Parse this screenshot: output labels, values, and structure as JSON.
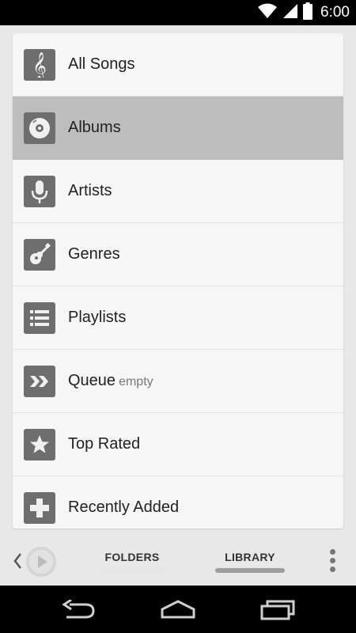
{
  "status_bar": {
    "time": "6:00",
    "icons": [
      "wifi-icon",
      "signal-icon",
      "battery-icon"
    ]
  },
  "library_menu": {
    "items": [
      {
        "label": "All Songs",
        "sub": "",
        "icon": "treble-clef-icon",
        "selected": false
      },
      {
        "label": "Albums",
        "sub": "",
        "icon": "disc-icon",
        "selected": true
      },
      {
        "label": "Artists",
        "sub": "",
        "icon": "microphone-icon",
        "selected": false
      },
      {
        "label": "Genres",
        "sub": "",
        "icon": "guitar-icon",
        "selected": false
      },
      {
        "label": "Playlists",
        "sub": "",
        "icon": "list-icon",
        "selected": false
      },
      {
        "label": "Queue",
        "sub": "empty",
        "icon": "queue-icon",
        "selected": false
      },
      {
        "label": "Top Rated",
        "sub": "",
        "icon": "star-icon",
        "selected": false
      },
      {
        "label": "Recently Added",
        "sub": "",
        "icon": "plus-icon",
        "selected": false
      }
    ]
  },
  "bottom_bar": {
    "tabs": [
      {
        "label": "FOLDERS",
        "active": false
      },
      {
        "label": "LIBRARY",
        "active": true
      }
    ]
  },
  "nav_bar": {
    "icons": [
      "back-icon",
      "home-icon",
      "recents-icon"
    ]
  },
  "colors": {
    "selected_row": "#bdbdbd",
    "icon_tile": "#6e6e6e",
    "active_tab_indicator": "#9e9e9e",
    "inactive_tab_indicator": "#e6e6e6"
  }
}
